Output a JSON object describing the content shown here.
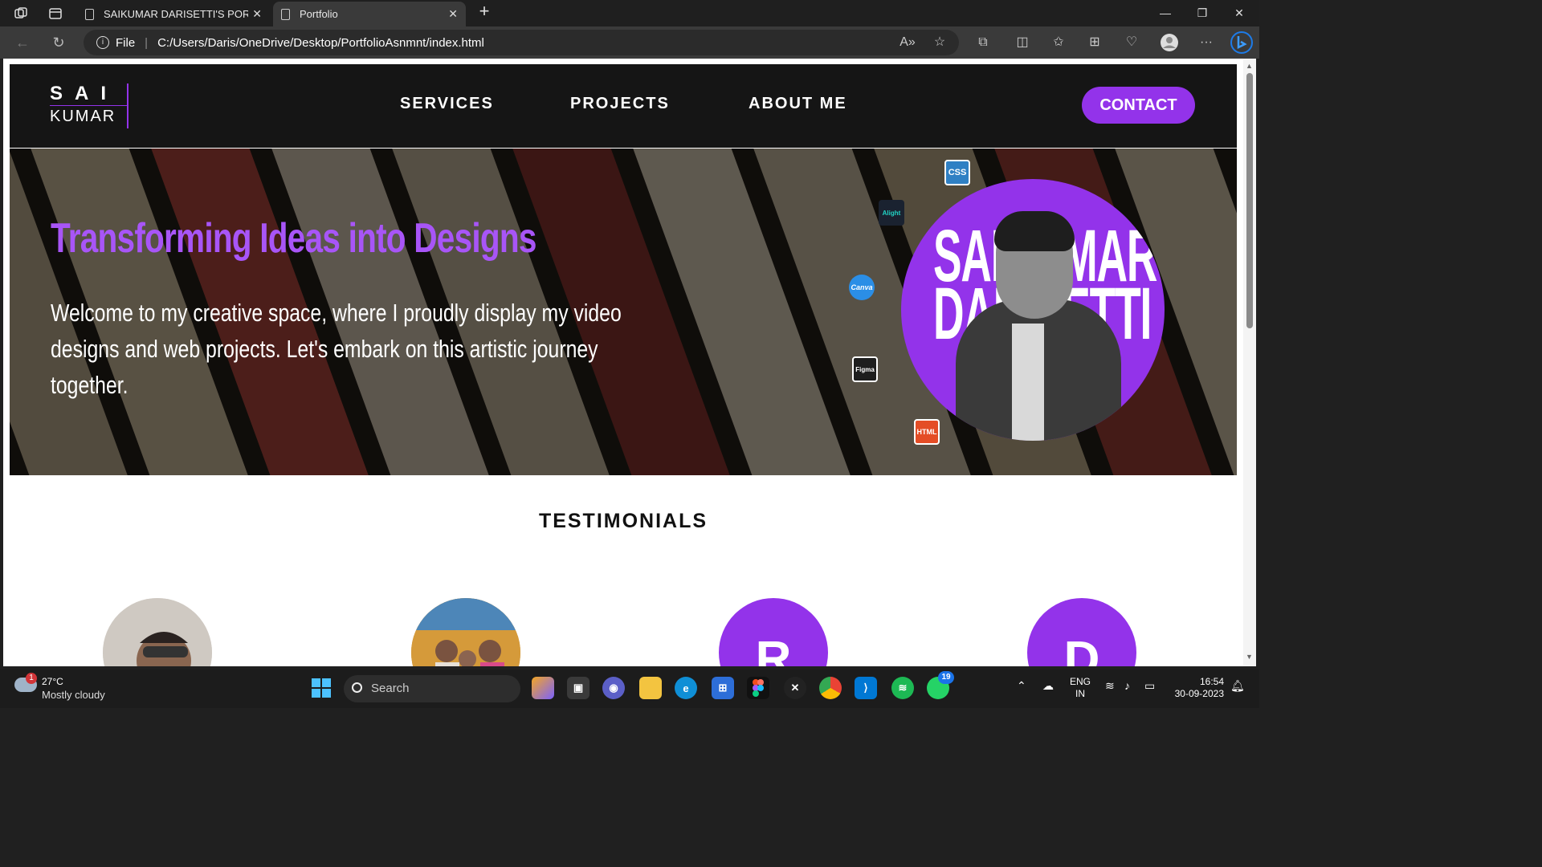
{
  "browser": {
    "tabs": [
      {
        "label": "SAIKUMAR DARISETTI'S PORTFO",
        "active": false
      },
      {
        "label": "Portfolio",
        "active": true
      }
    ],
    "url_scheme": "File",
    "url": "C:/Users/Daris/OneDrive/Desktop/PortfolioAsnmnt/index.html",
    "new_tab": "+",
    "close": "✕"
  },
  "site": {
    "logo_top": "SAI",
    "logo_bottom": "KUMAR",
    "nav": [
      "SERVICES",
      "PROJECTS",
      "ABOUT ME"
    ],
    "contact_label": "CONTACT",
    "hero_title": "Transforming Ideas into Designs",
    "hero_subtitle": "Welcome to my creative space, where I proudly display my video designs and web projects. Let's embark on this artistic journey together.",
    "portrait_text_1": "SAIKUMAR",
    "portrait_text_2": "DARISETTI",
    "badges": [
      "CSS",
      "Alight",
      "Canva",
      "Figma",
      "HTML"
    ],
    "testimonials_title": "TESTIMONIALS",
    "avatar_letters": [
      "R",
      "D"
    ]
  },
  "taskbar": {
    "weather_badge": "1",
    "temperature": "27°C",
    "condition": "Mostly cloudy",
    "search_label": "Search",
    "whatsapp_badge": "19",
    "lang_1": "ENG",
    "lang_2": "IN",
    "time": "16:54",
    "date": "30-09-2023"
  },
  "colors": {
    "accent": "#9333ea",
    "hero_title": "#a855f7",
    "header_bg": "#151515"
  }
}
